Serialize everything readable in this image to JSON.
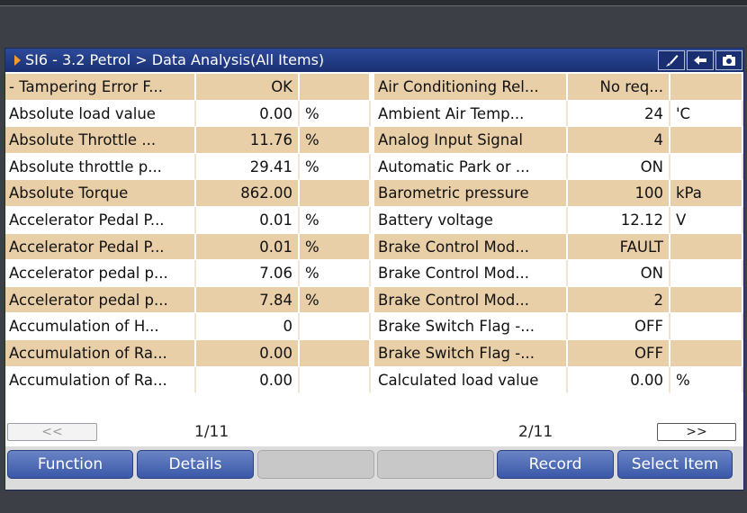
{
  "window": {
    "title": "SI6 - 3.2 Petrol > Data Analysis(All Items)",
    "icons": [
      "brush-icon",
      "back-arrow-icon",
      "camera-icon"
    ]
  },
  "left_rows": [
    {
      "name": "- Tampering Error F...",
      "value": "OK",
      "unit": ""
    },
    {
      "name": "Absolute load value",
      "value": "0.00",
      "unit": "%"
    },
    {
      "name": "Absolute Throttle ...",
      "value": "11.76",
      "unit": "%"
    },
    {
      "name": "Absolute throttle p...",
      "value": "29.41",
      "unit": "%"
    },
    {
      "name": "Absolute Torque",
      "value": "862.00",
      "unit": ""
    },
    {
      "name": "Accelerator Pedal P...",
      "value": "0.01",
      "unit": "%"
    },
    {
      "name": "Accelerator Pedal P...",
      "value": "0.01",
      "unit": "%"
    },
    {
      "name": "Accelerator pedal p...",
      "value": "7.06",
      "unit": "%"
    },
    {
      "name": "Accelerator pedal p...",
      "value": "7.84",
      "unit": "%"
    },
    {
      "name": "Accumulation of H...",
      "value": "0",
      "unit": ""
    },
    {
      "name": "Accumulation of Ra...",
      "value": "0.00",
      "unit": ""
    },
    {
      "name": "Accumulation of Ra...",
      "value": "0.00",
      "unit": ""
    }
  ],
  "right_rows": [
    {
      "name": "Air Conditioning Rel...",
      "value": "No req...",
      "unit": ""
    },
    {
      "name": "Ambient Air Temp...",
      "value": "24",
      "unit": "'C"
    },
    {
      "name": "Analog Input Signal",
      "value": "4",
      "unit": ""
    },
    {
      "name": "Automatic Park or ...",
      "value": "ON",
      "unit": ""
    },
    {
      "name": "Barometric pressure",
      "value": "100",
      "unit": "kPa"
    },
    {
      "name": "Battery voltage",
      "value": "12.12",
      "unit": "V"
    },
    {
      "name": "Brake Control Mod...",
      "value": "FAULT",
      "unit": ""
    },
    {
      "name": "Brake Control Mod...",
      "value": "ON",
      "unit": ""
    },
    {
      "name": "Brake Control Mod...",
      "value": "2",
      "unit": ""
    },
    {
      "name": "Brake Switch Flag -...",
      "value": "OFF",
      "unit": ""
    },
    {
      "name": "Brake Switch Flag -...",
      "value": "OFF",
      "unit": ""
    },
    {
      "name": "Calculated load value",
      "value": "0.00",
      "unit": "%"
    }
  ],
  "pager": {
    "prev_label": "<<",
    "next_label": ">>",
    "left_page": "1/11",
    "right_page": "2/11"
  },
  "buttons": {
    "function": "Function",
    "details": "Details",
    "record": "Record",
    "select_item": "Select Item"
  },
  "colors": {
    "title_bar": "#1a2f72",
    "row_highlight": "#e9cfa8",
    "accent_arrow": "#f29a2e",
    "button_blue": "#3a58a8"
  }
}
